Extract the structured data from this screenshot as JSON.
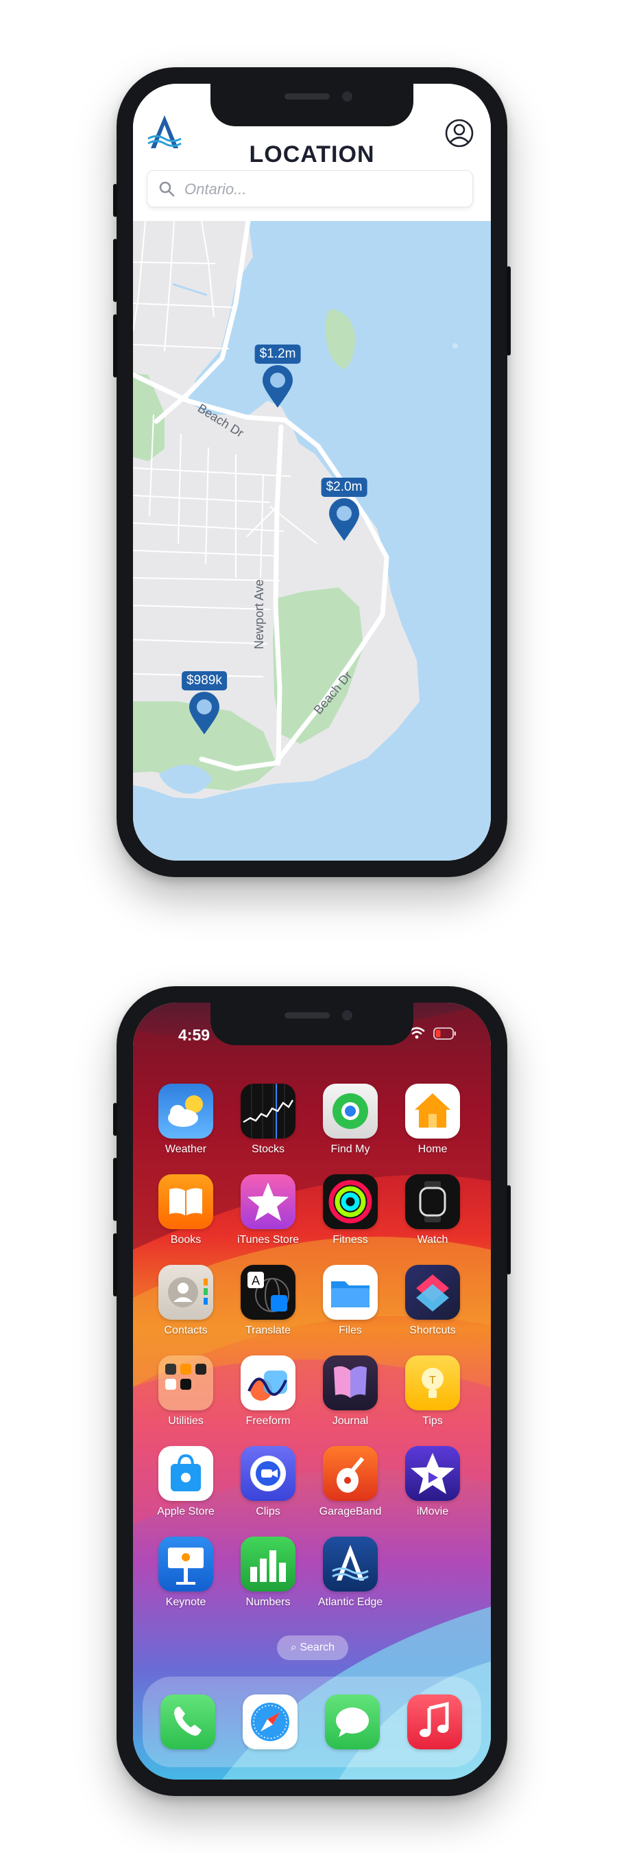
{
  "map_app": {
    "title": "LOCATION",
    "search_placeholder": "Ontario...",
    "streets": {
      "beach_dr_north": "Beach Dr",
      "beach_dr_south": "Beach Dr",
      "newport_ave": "Newport Ave"
    },
    "listings": [
      {
        "price": "$1.2m"
      },
      {
        "price": "$2.0m"
      },
      {
        "price": "$989k"
      }
    ],
    "colors": {
      "brand": "#1f5fa8",
      "water": "#b3d8f4",
      "land": "#e8e8ea",
      "park": "#bde0bb"
    }
  },
  "home_screen": {
    "time": "4:59",
    "search_pill": "Search",
    "apps": [
      {
        "label": "Weather"
      },
      {
        "label": "Stocks"
      },
      {
        "label": "Find My"
      },
      {
        "label": "Home"
      },
      {
        "label": "Books"
      },
      {
        "label": "iTunes Store"
      },
      {
        "label": "Fitness"
      },
      {
        "label": "Watch"
      },
      {
        "label": "Contacts"
      },
      {
        "label": "Translate"
      },
      {
        "label": "Files"
      },
      {
        "label": "Shortcuts"
      },
      {
        "label": "Utilities"
      },
      {
        "label": "Freeform"
      },
      {
        "label": "Journal"
      },
      {
        "label": "Tips"
      },
      {
        "label": "Apple Store"
      },
      {
        "label": "Clips"
      },
      {
        "label": "GarageBand"
      },
      {
        "label": "iMovie"
      },
      {
        "label": "Keynote"
      },
      {
        "label": "Numbers"
      },
      {
        "label": "Atlantic Edge"
      }
    ],
    "dock": [
      "phone-icon",
      "safari-icon",
      "messages-icon",
      "music-icon"
    ]
  }
}
